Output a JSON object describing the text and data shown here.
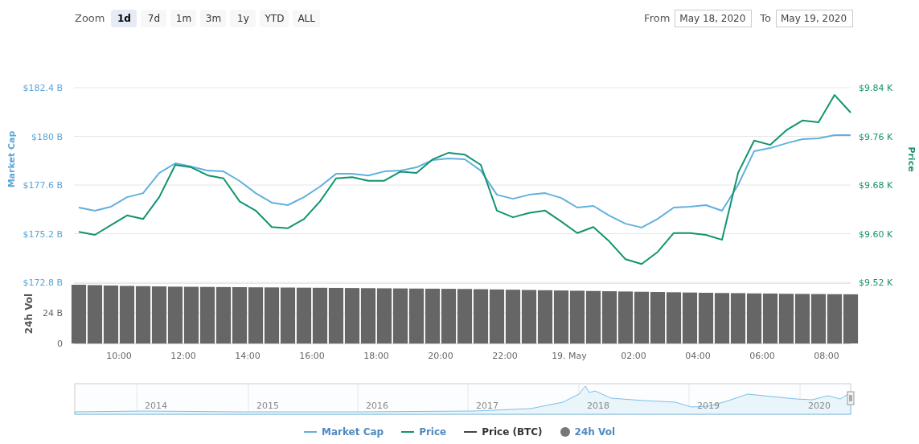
{
  "toolbar": {
    "zoom_label": "Zoom",
    "ranges": [
      {
        "label": "1d",
        "selected": true
      },
      {
        "label": "7d",
        "selected": false
      },
      {
        "label": "1m",
        "selected": false
      },
      {
        "label": "3m",
        "selected": false
      },
      {
        "label": "1y",
        "selected": false
      },
      {
        "label": "YTD",
        "selected": false
      },
      {
        "label": "ALL",
        "selected": false
      }
    ],
    "from_label": "From",
    "from_value": "May 18, 2020",
    "to_label": "To",
    "to_value": "May 19, 2020"
  },
  "price_chart": {
    "chart_data": {
      "type": "line",
      "grid": true,
      "ylabel": "Market Cap",
      "y2label": "Price",
      "xlim": [
        "2020-05-18T08:36",
        "2020-05-19T08:45"
      ],
      "x": [
        "2020-05-18T08:45",
        "2020-05-18T09:15",
        "2020-05-18T09:45",
        "2020-05-18T10:15",
        "2020-05-18T10:45",
        "2020-05-18T11:15",
        "2020-05-18T11:45",
        "2020-05-18T12:15",
        "2020-05-18T12:45",
        "2020-05-18T13:15",
        "2020-05-18T13:45",
        "2020-05-18T14:15",
        "2020-05-18T14:45",
        "2020-05-18T15:15",
        "2020-05-18T15:45",
        "2020-05-18T16:15",
        "2020-05-18T16:45",
        "2020-05-18T17:15",
        "2020-05-18T17:45",
        "2020-05-18T18:15",
        "2020-05-18T18:45",
        "2020-05-18T19:15",
        "2020-05-18T19:45",
        "2020-05-18T20:15",
        "2020-05-18T20:45",
        "2020-05-18T21:15",
        "2020-05-18T21:45",
        "2020-05-18T22:15",
        "2020-05-18T22:45",
        "2020-05-18T23:15",
        "2020-05-18T23:45",
        "2020-05-19T00:15",
        "2020-05-19T00:45",
        "2020-05-19T01:15",
        "2020-05-19T01:45",
        "2020-05-19T02:15",
        "2020-05-19T02:45",
        "2020-05-19T03:15",
        "2020-05-19T03:45",
        "2020-05-19T04:15",
        "2020-05-19T04:45",
        "2020-05-19T05:15",
        "2020-05-19T05:45",
        "2020-05-19T06:15",
        "2020-05-19T06:45",
        "2020-05-19T07:15",
        "2020-05-19T07:45",
        "2020-05-19T08:15",
        "2020-05-19T08:45"
      ],
      "ylim": [
        172.8,
        182.4
      ],
      "yticks": [
        {
          "value": 172.8,
          "label": "$172.8 B"
        },
        {
          "value": 175.2,
          "label": "$175.2 B"
        },
        {
          "value": 177.6,
          "label": "$177.6 B"
        },
        {
          "value": 180,
          "label": "$180 B"
        },
        {
          "value": 182.4,
          "label": "$182.4 B"
        }
      ],
      "y2lim": [
        9.52,
        9.84
      ],
      "y2ticks": [
        {
          "value": 9.52,
          "label": "$9.52 K"
        },
        {
          "value": 9.6,
          "label": "$9.60 K"
        },
        {
          "value": 9.68,
          "label": "$9.68 K"
        },
        {
          "value": 9.76,
          "label": "$9.76 K"
        },
        {
          "value": 9.84,
          "label": "$9.84 K"
        }
      ],
      "series": [
        {
          "color": "#62b0de",
          "values": [
            176.49,
            176.33,
            176.53,
            177.0,
            177.2,
            178.19,
            178.67,
            178.51,
            178.31,
            178.27,
            177.8,
            177.2,
            176.73,
            176.61,
            177.0,
            177.52,
            178.15,
            178.15,
            178.07,
            178.27,
            178.31,
            178.47,
            178.83,
            178.91,
            178.87,
            178.31,
            177.12,
            176.92,
            177.12,
            177.2,
            176.96,
            176.49,
            176.57,
            176.09,
            175.69,
            175.5,
            175.93,
            176.49,
            176.53,
            176.61,
            176.33,
            177.6,
            179.27,
            179.42,
            179.66,
            179.86,
            179.9,
            180.06,
            180.06
          ]
        },
        {
          "color": "#11946f",
          "axis": "y2",
          "values": [
            9.603,
            9.598,
            9.614,
            9.63,
            9.624,
            9.66,
            9.713,
            9.709,
            9.696,
            9.691,
            9.653,
            9.638,
            9.611,
            9.609,
            9.624,
            9.653,
            9.691,
            9.693,
            9.687,
            9.687,
            9.702,
            9.7,
            9.722,
            9.733,
            9.73,
            9.713,
            9.638,
            9.627,
            9.634,
            9.638,
            9.62,
            9.601,
            9.611,
            9.587,
            9.558,
            9.55,
            9.57,
            9.601,
            9.601,
            9.598,
            9.59,
            9.7,
            9.753,
            9.746,
            9.77,
            9.786,
            9.783,
            9.828,
            9.799
          ]
        }
      ]
    }
  },
  "volume_chart": {
    "chart_data": {
      "type": "bar",
      "grid": true,
      "ylabel": "24h Vol",
      "xlim": [
        "2020-05-18T08:36",
        "2020-05-19T08:45"
      ],
      "ylim": [
        0,
        48
      ],
      "x": [
        "2020-05-18T08:45",
        "2020-05-18T09:15",
        "2020-05-18T09:45",
        "2020-05-18T10:15",
        "2020-05-18T10:45",
        "2020-05-18T11:15",
        "2020-05-18T11:45",
        "2020-05-18T12:15",
        "2020-05-18T12:45",
        "2020-05-18T13:15",
        "2020-05-18T13:45",
        "2020-05-18T14:15",
        "2020-05-18T14:45",
        "2020-05-18T15:15",
        "2020-05-18T15:45",
        "2020-05-18T16:15",
        "2020-05-18T16:45",
        "2020-05-18T17:15",
        "2020-05-18T17:45",
        "2020-05-18T18:15",
        "2020-05-18T18:45",
        "2020-05-18T19:15",
        "2020-05-18T19:45",
        "2020-05-18T20:15",
        "2020-05-18T20:45",
        "2020-05-18T21:15",
        "2020-05-18T21:45",
        "2020-05-18T22:15",
        "2020-05-18T22:45",
        "2020-05-18T23:15",
        "2020-05-18T23:45",
        "2020-05-19T00:15",
        "2020-05-19T00:45",
        "2020-05-19T01:15",
        "2020-05-19T01:45",
        "2020-05-19T02:15",
        "2020-05-19T02:45",
        "2020-05-19T03:15",
        "2020-05-19T03:45",
        "2020-05-19T04:15",
        "2020-05-19T04:45",
        "2020-05-19T05:15",
        "2020-05-19T05:45",
        "2020-05-19T06:15",
        "2020-05-19T06:45",
        "2020-05-19T07:15",
        "2020-05-19T07:45",
        "2020-05-19T08:15",
        "2020-05-19T08:45"
      ],
      "yticks": [
        {
          "value": 0,
          "label": "0"
        },
        {
          "value": 24,
          "label": "24 B"
        }
      ],
      "xticks": [
        {
          "value": "2020-05-18T10:00",
          "label": "10:00"
        },
        {
          "value": "2020-05-18T12:00",
          "label": "12:00"
        },
        {
          "value": "2020-05-18T14:00",
          "label": "14:00"
        },
        {
          "value": "2020-05-18T16:00",
          "label": "16:00"
        },
        {
          "value": "2020-05-18T18:00",
          "label": "18:00"
        },
        {
          "value": "2020-05-18T20:00",
          "label": "20:00"
        },
        {
          "value": "2020-05-18T22:00",
          "label": "22:00"
        },
        {
          "value": "2020-05-19T00:00",
          "label": "19. May"
        },
        {
          "value": "2020-05-19T02:00",
          "label": "02:00"
        },
        {
          "value": "2020-05-19T04:00",
          "label": "04:00"
        },
        {
          "value": "2020-05-19T06:00",
          "label": "06:00"
        },
        {
          "value": "2020-05-19T08:00",
          "label": "08:00"
        }
      ],
      "series": [
        {
          "color": "#666666",
          "values": [
            46.1,
            45.8,
            45.5,
            45.2,
            45,
            44.8,
            44.6,
            44.5,
            44.4,
            44.3,
            44.2,
            44.1,
            44,
            43.9,
            43.8,
            43.7,
            43.6,
            43.5,
            43.4,
            43.3,
            43.2,
            43.1,
            43,
            42.9,
            42.8,
            42.6,
            42.4,
            42.2,
            42,
            41.8,
            41.6,
            41.4,
            41.2,
            41,
            40.8,
            40.6,
            40.4,
            40.2,
            40,
            39.8,
            39.6,
            39.5,
            39.3,
            39.2,
            39,
            38.9,
            38.8,
            38.7,
            38.6
          ]
        }
      ]
    }
  },
  "navigator": {
    "years": [
      "2014",
      "2015",
      "2016",
      "2017",
      "2018",
      "2019",
      "2020"
    ]
  },
  "legend": [
    {
      "label": "Market Cap",
      "kind": "line",
      "color": "#62b0de",
      "hovered": false
    },
    {
      "label": "Price",
      "kind": "line",
      "color": "#11946f",
      "hovered": false
    },
    {
      "label": "Price (BTC)",
      "kind": "line",
      "color": "#444444",
      "hovered": true
    },
    {
      "label": "24h Vol",
      "kind": "dot",
      "color": "#777777",
      "hovered": false
    }
  ]
}
